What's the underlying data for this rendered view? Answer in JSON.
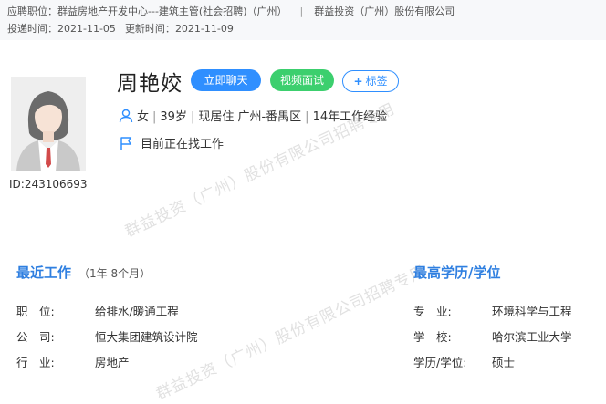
{
  "header": {
    "applied_position_label": "应聘职位：",
    "applied_position": "群益房地产开发中心---建筑主管(社会招聘)",
    "location": "（广州）",
    "divider": "|",
    "company": "群益投资（广州）股份有限公司",
    "delivery_time_label": "投递时间：",
    "delivery_time": "2021-11-05",
    "update_time_label": "更新时间：",
    "update_time": "2021-11-09"
  },
  "profile": {
    "name": "周艳姣",
    "id_text": "ID:243106693",
    "gender": "女",
    "age": "39岁",
    "residence": "现居住 广州-番禺区",
    "experience": "14年工作经验",
    "job_status": "目前正在找工作"
  },
  "buttons": {
    "chat": "立即聊天",
    "video": "视频面试",
    "tag": "标签"
  },
  "recent_work": {
    "title": "最近工作",
    "duration": "（1年 8个月）",
    "rows": [
      {
        "label": "职　位:",
        "value": "给排水/暖通工程"
      },
      {
        "label": "公　司:",
        "value": "恒大集团建筑设计院"
      },
      {
        "label": "行　业:",
        "value": "房地产"
      }
    ]
  },
  "education": {
    "title": "最高学历/学位",
    "rows": [
      {
        "label": "专　业:",
        "value": "环境科学与工程"
      },
      {
        "label": "学　校:",
        "value": "哈尔滨工业大学"
      },
      {
        "label": "学历/学位:",
        "value": "硕士"
      }
    ]
  },
  "watermark": {
    "text1": "群益投资（广州）股份有限公司招聘专用",
    "text2": "群益投资（广州）股份有限公司招聘专用"
  },
  "colors": {
    "accent": "#2f8fff",
    "video": "#3ccf6e",
    "section_title": "#2f7fe0"
  }
}
